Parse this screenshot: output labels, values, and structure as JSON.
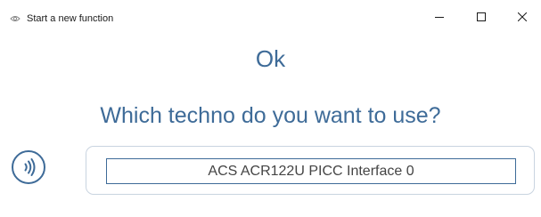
{
  "window": {
    "title": "Start a new function",
    "app_icon": "eye-icon",
    "controls": {
      "minimize_icon": "minimize-icon",
      "maximize_icon": "maximize-icon",
      "close_icon": "close-icon"
    }
  },
  "main": {
    "status": "Ok",
    "question": "Which techno do you want to use?",
    "techno_icon": "nfc-contactless-icon",
    "reader_option": "ACS ACR122U PICC Interface 0"
  },
  "colors": {
    "accent": "#3e6b98",
    "panel_border": "#c9d4e0",
    "text": "#444444"
  }
}
